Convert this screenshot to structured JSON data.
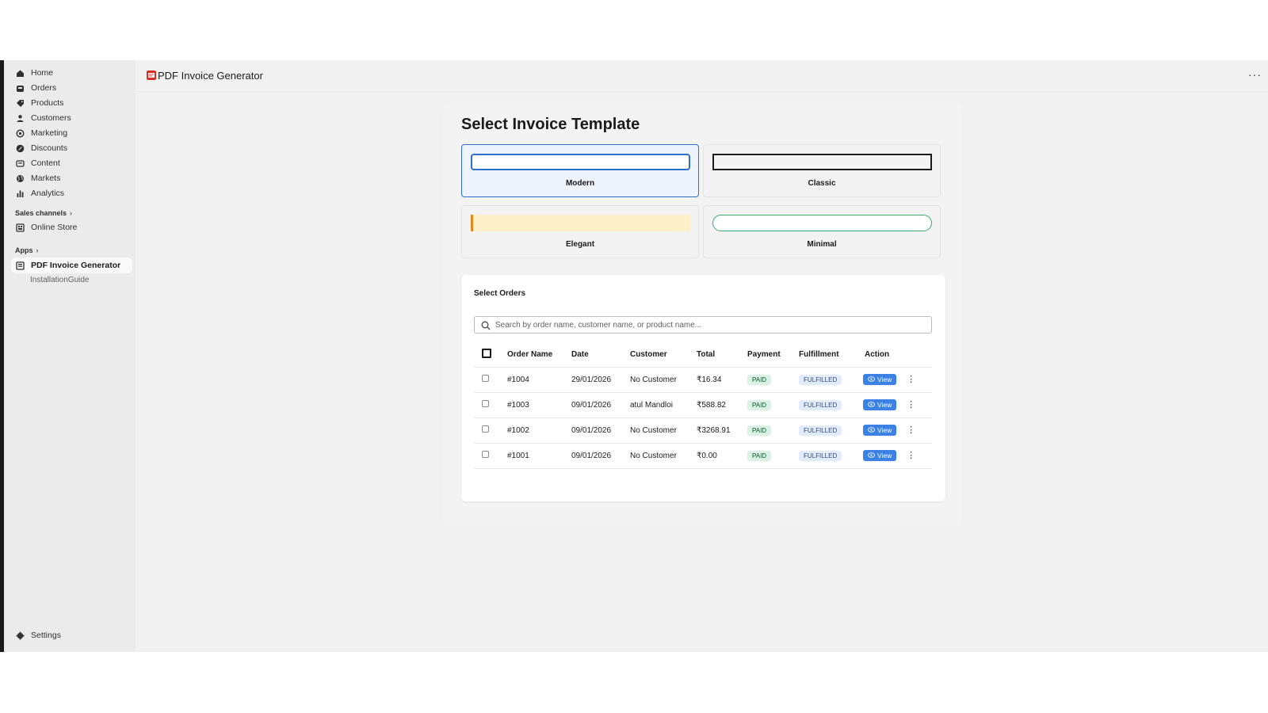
{
  "sidebar": {
    "items": [
      {
        "label": "Home",
        "icon": "home-icon"
      },
      {
        "label": "Orders",
        "icon": "inbox-icon"
      },
      {
        "label": "Products",
        "icon": "tag-icon"
      },
      {
        "label": "Customers",
        "icon": "person-icon"
      },
      {
        "label": "Marketing",
        "icon": "target-icon"
      },
      {
        "label": "Discounts",
        "icon": "discount-icon"
      },
      {
        "label": "Content",
        "icon": "content-icon"
      },
      {
        "label": "Markets",
        "icon": "globe-icon"
      },
      {
        "label": "Analytics",
        "icon": "bar-chart-icon"
      }
    ],
    "sales_channels_label": "Sales channels",
    "online_store_label": "Online Store",
    "apps_label": "Apps",
    "app_item_label": "PDF Invoice Generator",
    "app_sub_item_label": "InstallationGuide",
    "settings_label": "Settings"
  },
  "header": {
    "title": "PDF Invoice Generator",
    "more_label": "···"
  },
  "page": {
    "title": "Select Invoice Template",
    "templates": [
      {
        "label": "Modern",
        "selected": true
      },
      {
        "label": "Classic",
        "selected": false
      },
      {
        "label": "Elegant",
        "selected": false
      },
      {
        "label": "Minimal",
        "selected": false
      }
    ]
  },
  "orders": {
    "title": "Select Orders",
    "search_placeholder": "Search by order name, customer name, or product name...",
    "columns": [
      "Order Name",
      "Date",
      "Customer",
      "Total",
      "Payment",
      "Fulfillment",
      "Action"
    ],
    "rows": [
      {
        "order": "#1004",
        "date": "29/01/2026",
        "customer": "No Customer",
        "total": "₹16.34",
        "payment": "PAID",
        "fulfillment": "FULFILLED",
        "action": "View"
      },
      {
        "order": "#1003",
        "date": "09/01/2026",
        "customer": "atul Mandloi",
        "total": "₹588.82",
        "payment": "PAID",
        "fulfillment": "FULFILLED",
        "action": "View"
      },
      {
        "order": "#1002",
        "date": "09/01/2026",
        "customer": "No Customer",
        "total": "₹3268.91",
        "payment": "PAID",
        "fulfillment": "FULFILLED",
        "action": "View"
      },
      {
        "order": "#1001",
        "date": "09/01/2026",
        "customer": "No Customer",
        "total": "₹0.00",
        "payment": "PAID",
        "fulfillment": "FULFILLED",
        "action": "View"
      }
    ]
  },
  "colors": {
    "accent": "#3c82e5",
    "selected_border": "#2c6ecb",
    "paid_bg": "#d9f2e3",
    "fulfilled_bg": "#e2ebfa",
    "elegant_fill": "#fdf0c8",
    "elegant_bar": "#e08a1e",
    "minimal_border": "#3aa86b"
  }
}
